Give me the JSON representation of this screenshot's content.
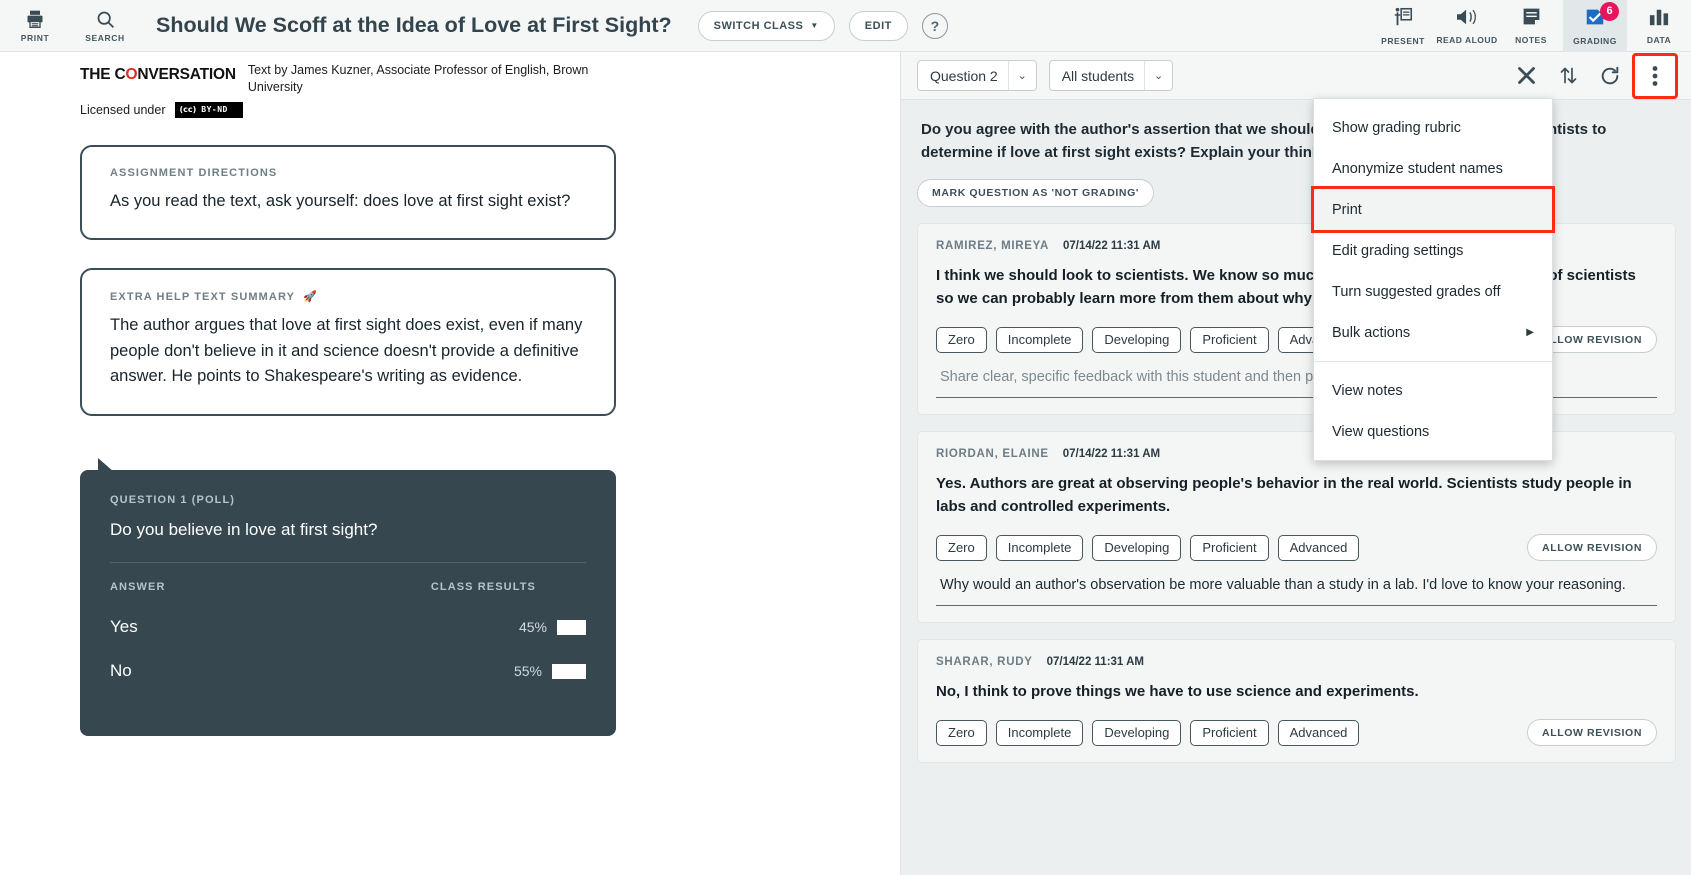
{
  "topbar": {
    "left_buttons": [
      {
        "label": "PRINT",
        "icon": "printer-icon"
      },
      {
        "label": "SEARCH",
        "icon": "search-icon"
      }
    ],
    "title": "Should We Scoff at the Idea of Love at First Sight?",
    "switch_class_label": "SWITCH CLASS",
    "edit_label": "EDIT",
    "help_label": "?",
    "tabs": [
      {
        "label": "PRESENT",
        "icon": "presenter-icon",
        "active": false,
        "badge": ""
      },
      {
        "label": "READ ALOUD",
        "icon": "speaker-icon",
        "active": false,
        "badge": ""
      },
      {
        "label": "NOTES",
        "icon": "notes-icon",
        "active": false,
        "badge": ""
      },
      {
        "label": "GRADING",
        "icon": "grading-check-icon",
        "active": true,
        "badge": "6"
      },
      {
        "label": "DATA",
        "icon": "bar-chart-icon",
        "active": false,
        "badge": ""
      }
    ],
    "badge_color": "#e8155c"
  },
  "reader": {
    "source_logo": {
      "prefix": "THE C",
      "accent_letter": "O",
      "suffix": "NVERSATION",
      "accent_color": "#e02b20"
    },
    "byline": "Text by James Kuzner, Associate Professor of English, Brown University",
    "licensed_label": "Licensed under",
    "license_badge": {
      "left": "(cc)",
      "right": "BY-ND"
    },
    "directions": {
      "kicker": "ASSIGNMENT DIRECTIONS",
      "body": "As you read the text, ask yourself: does love at first sight exist?"
    },
    "summary": {
      "kicker": "EXTRA HELP TEXT SUMMARY",
      "kicker_icon": "🚀",
      "body": "The author argues that love at first sight does exist, even if many people don't believe in it and science doesn't provide a definitive answer. He points to Shakespeare's writing as evidence."
    },
    "poll": {
      "kicker": "QUESTION 1 (POLL)",
      "question": "Do you believe in love at first sight?",
      "col_answer": "ANSWER",
      "col_results": "CLASS RESULTS",
      "rows": [
        {
          "answer": "Yes",
          "pct_label": "45%",
          "pct": 45
        },
        {
          "answer": "No",
          "pct_label": "55%",
          "pct": 55
        }
      ]
    }
  },
  "grading": {
    "question_select": "Question 2",
    "students_select": "All students",
    "actions": [
      {
        "name": "close-icon",
        "glyph": "✕"
      },
      {
        "name": "sort-icon",
        "glyph": "⇅"
      },
      {
        "name": "refresh-icon",
        "glyph": "↻"
      },
      {
        "name": "kebab-menu-icon",
        "glyph": "⋮"
      }
    ],
    "question_prompt": "Do you agree with the author's assertion that we should look to authors rather than scientists to determine if love at first sight exists? Explain your thinking.",
    "not_grading_label": "MARK QUESTION AS 'NOT GRADING'",
    "grade_options": [
      "Zero",
      "Incomplete",
      "Developing",
      "Proficient",
      "Advanced"
    ],
    "allow_revision_label": "ALLOW REVISION",
    "responses": [
      {
        "name": "RAMIREZ, MIREYA",
        "timestamp": "07/14/22 11:31 AM",
        "text": "I think we should look to scientists. We know so much more about the world because of scientists so we can probably learn more from them about why people fall in love.",
        "feedback_placeholder": "Share clear, specific feedback with this student and then press enter.",
        "feedback_value": ""
      },
      {
        "name": "RIORDAN, ELAINE",
        "timestamp": "07/14/22 11:31 AM",
        "text": "Yes. Authors are great at observing people's behavior in the real world. Scientists study people in labs and controlled experiments.",
        "feedback_placeholder": "",
        "feedback_value": "Why would an author's observation be more valuable than a study in a lab. I'd love to know your reasoning."
      },
      {
        "name": "SHARAR, RUDY",
        "timestamp": "07/14/22 11:31 AM",
        "text": "No, I think to prove things we have to use science and experiments.",
        "feedback_placeholder": "",
        "feedback_value": ""
      }
    ]
  },
  "menu": {
    "items": [
      {
        "label": "Show grading rubric",
        "highlighted": false,
        "submenu": false,
        "sep_after": false
      },
      {
        "label": "Anonymize student names",
        "highlighted": false,
        "submenu": false,
        "sep_after": false
      },
      {
        "label": "Print",
        "highlighted": true,
        "submenu": false,
        "sep_after": false
      },
      {
        "label": "Edit grading settings",
        "highlighted": false,
        "submenu": false,
        "sep_after": false
      },
      {
        "label": "Turn suggested grades off",
        "highlighted": false,
        "submenu": false,
        "sep_after": false
      },
      {
        "label": "Bulk actions",
        "highlighted": false,
        "submenu": true,
        "sep_after": true
      },
      {
        "label": "View notes",
        "highlighted": false,
        "submenu": false,
        "sep_after": false
      },
      {
        "label": "View questions",
        "highlighted": false,
        "submenu": false,
        "sep_after": false
      }
    ],
    "highlight_color": "#fd2a17"
  }
}
